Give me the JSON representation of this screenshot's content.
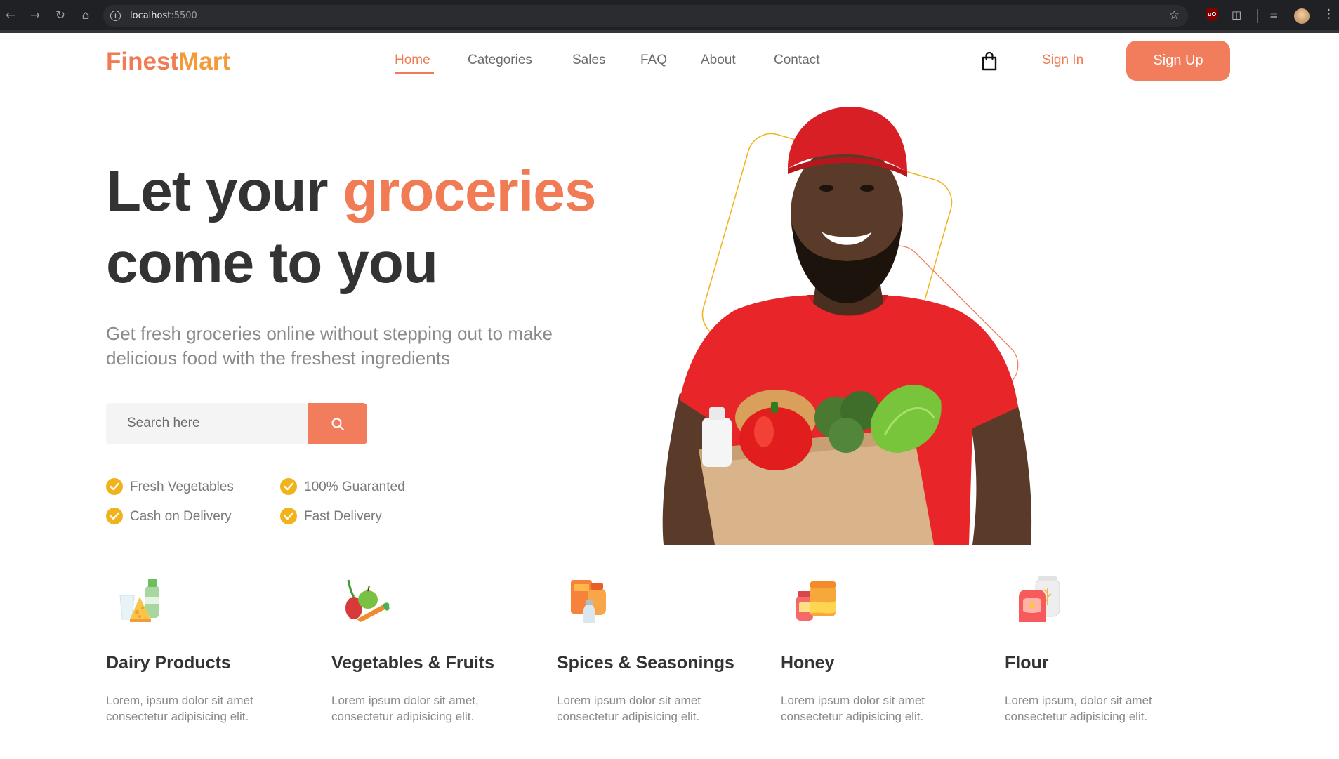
{
  "browser": {
    "url_host": "localhost",
    "url_port": ":5500",
    "back_icon": "arrow-left-icon",
    "forward_icon": "arrow-right-icon",
    "reload_icon": "reload-icon",
    "home_icon": "home-icon",
    "bookmark_icon": "star-icon"
  },
  "header": {
    "logo_part1": "Finest",
    "logo_part2": "Mart",
    "nav": [
      "Home",
      "Categories",
      "Sales",
      "FAQ",
      "About",
      "Contact"
    ],
    "active_nav": "Home",
    "signin_label": "Sign In",
    "signup_label": "Sign Up",
    "cart_icon": "shopping-bag-icon"
  },
  "hero": {
    "title_part1": "Let your ",
    "title_accent": "groceries",
    "title_line2": "come to you",
    "subtitle": "Get fresh groceries online without stepping out to make delicious food with the freshest ingredients",
    "search_placeholder": "Search here",
    "features": [
      "Fresh Vegetables",
      "100% Guaranted",
      "Cash on Delivery",
      "Fast Delivery"
    ]
  },
  "categories": [
    {
      "title": "Dairy Products",
      "desc": "Lorem, ipsum dolor sit amet consectetur adipisicing elit.",
      "icon": "dairy-icon"
    },
    {
      "title": "Vegetables & Fruits",
      "desc": "Lorem ipsum dolor sit amet, consectetur adipisicing elit.",
      "icon": "vegetables-icon"
    },
    {
      "title": "Spices & Seasonings",
      "desc": "Lorem ipsum dolor sit amet consectetur adipisicing elit.",
      "icon": "spices-icon"
    },
    {
      "title": "Honey",
      "desc": "Lorem ipsum dolor sit amet consectetur adipisicing elit.",
      "icon": "honey-icon"
    },
    {
      "title": "Flour",
      "desc": "Lorem ipsum, dolor sit amet consectetur adipisicing elit.",
      "icon": "flour-icon"
    }
  ],
  "colors": {
    "accent": "#f17b54",
    "logo_secondary": "#f39b3a",
    "check": "#f2b21b",
    "heading": "#333333",
    "muted": "#8a8a8a"
  }
}
